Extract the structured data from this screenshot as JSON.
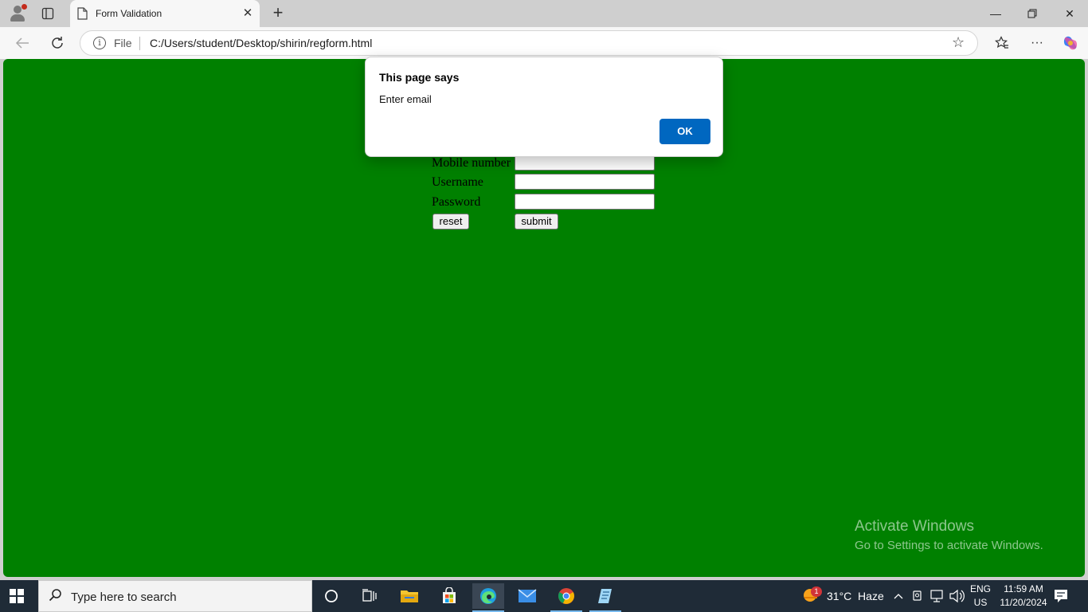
{
  "browser": {
    "tab_title": "Form Validation",
    "address": {
      "scheme_label": "File",
      "url": "C:/Users/student/Desktop/shirin/regform.html"
    }
  },
  "form": {
    "fields": [
      {
        "label": "Mobile number"
      },
      {
        "label": "Username"
      },
      {
        "label": "Password"
      }
    ],
    "reset_label": "reset",
    "submit_label": "submit"
  },
  "dialog": {
    "title": "This page says",
    "message": "Enter email",
    "ok_label": "OK"
  },
  "watermark": {
    "line1": "Activate Windows",
    "line2": "Go to Settings to activate Windows."
  },
  "taskbar": {
    "search_placeholder": "Type here to search",
    "weather": "31°C  Haze",
    "weather_badge": "1",
    "lang_top": "ENG",
    "lang_bottom": "US",
    "time": "11:59 AM",
    "date": "11/20/2024"
  },
  "colors": {
    "page_background": "#008000",
    "dialog_ok": "#0067c0",
    "taskbar": "#1f2b37"
  }
}
